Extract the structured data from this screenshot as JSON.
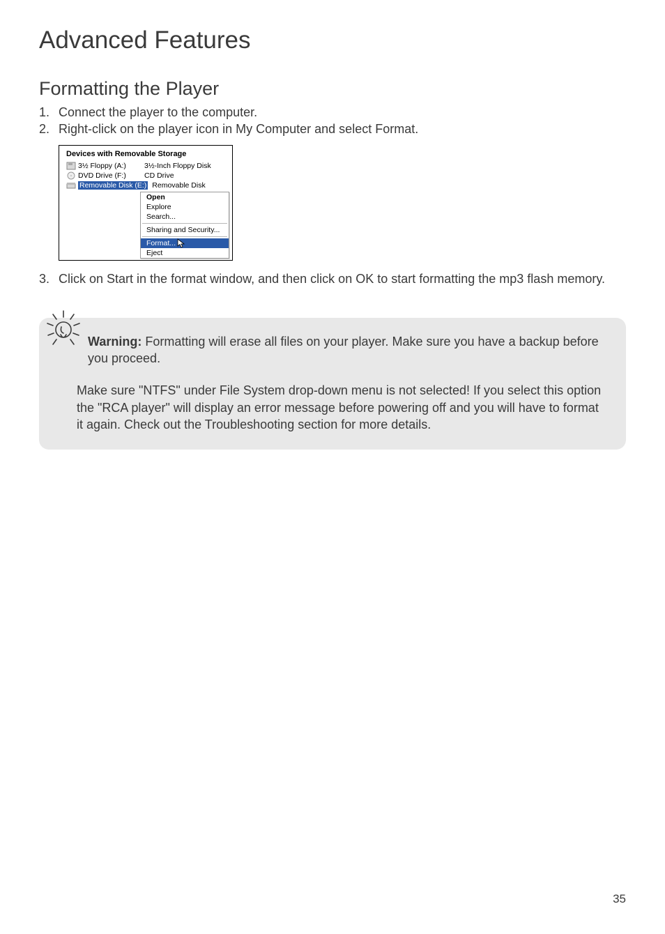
{
  "title": "Advanced Features",
  "section": "Formatting the Player",
  "steps": {
    "s1_num": "1.",
    "s1": "Connect the player to the computer.",
    "s2_num": "2.",
    "s2": "Right-click on the player icon in My Computer and select Format.",
    "s3_num": "3.",
    "s3": "Click on Start in the format window, and then click on OK to start formatting the mp3 flash memory."
  },
  "screenshot": {
    "heading": "Devices with Removable Storage",
    "rows": [
      {
        "name": "3½ Floppy (A:)",
        "type": "3½-Inch Floppy Disk"
      },
      {
        "name": "DVD Drive (F:)",
        "type": "CD Drive"
      },
      {
        "name": "Removable Disk (E:)",
        "type": "Removable Disk",
        "selected": true
      }
    ],
    "menu": {
      "open": "Open",
      "explore": "Explore",
      "search": "Search...",
      "sharing": "Sharing and Security...",
      "format": "Format...",
      "eject": "Eject"
    }
  },
  "warning": {
    "label": "Warning:",
    "text1": " Formatting will erase all files on your player. Make sure you have a backup before you proceed.",
    "text2": "Make sure \"NTFS\" under File System drop-down menu is not selected! If you select this option the \"RCA player\" will display an error message before powering off and you will have to format it again. Check out the Troubleshooting section for more details."
  },
  "page_number": "35"
}
